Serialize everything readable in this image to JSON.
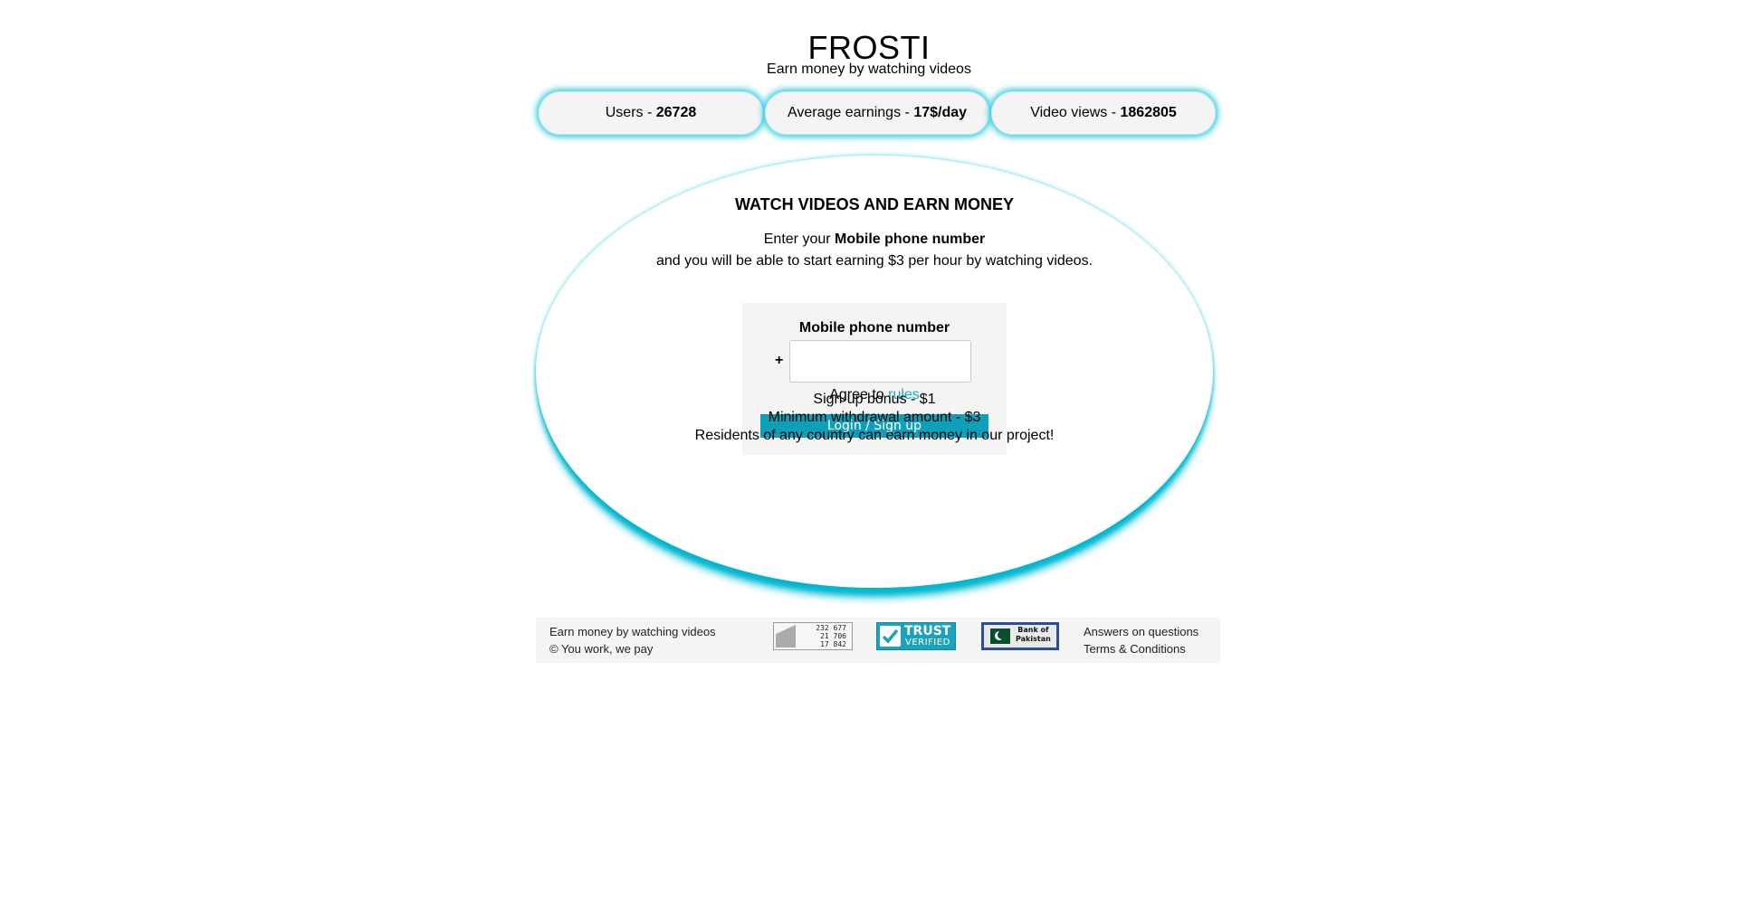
{
  "header": {
    "title": "FROSTI",
    "subtitle": "Earn money by watching videos"
  },
  "stats": [
    {
      "label": "Users - ",
      "value": "26728"
    },
    {
      "label": "Average earnings - ",
      "value": "17$/day"
    },
    {
      "label": "Video views - ",
      "value": "1862805"
    }
  ],
  "main": {
    "heading": "WATCH VIDEOS AND EARN MONEY",
    "intro_prefix": "Enter your ",
    "intro_bold": "Mobile phone number",
    "intro_line2": "and you will be able to start earning $3 per hour by watching videos.",
    "form": {
      "label": "Mobile phone number",
      "plus": "+",
      "phone_value": "",
      "phone_placeholder": "",
      "agree_prefix": "Agree to ",
      "agree_link": "rules",
      "submit_label": "Login / Sign up"
    },
    "info": [
      "Sign-up bonus - $1",
      "Minimum withdrawal amount - $3",
      "Residents of any country can earn money in our project!"
    ]
  },
  "footer": {
    "tagline": "Earn money by watching videos",
    "copyright": "© You work, we pay",
    "counter": [
      "232 677",
      "21 706",
      "17 842"
    ],
    "trust_title": "TRUST",
    "trust_sub": "VERIFIED",
    "bank_name_1": "Bank of",
    "bank_name_2": "Pakistan",
    "links": [
      "Answers on questions",
      "Terms & Conditions"
    ]
  },
  "colors": {
    "accent": "#0f9fb9",
    "link": "#17a7c1",
    "glow": "#00b6cf",
    "panel": "#f4f4f4"
  }
}
